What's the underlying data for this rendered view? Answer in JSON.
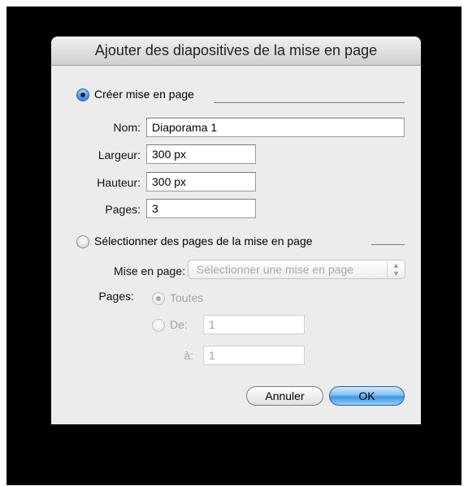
{
  "dialog": {
    "title": "Ajouter des diapositives de la mise en page",
    "create_option": {
      "label": "Créer mise en page",
      "selected": true,
      "fields": {
        "name_label": "Nom:",
        "name_value": "Diaporama 1",
        "width_label": "Largeur:",
        "width_value": "300 px",
        "height_label": "Hauteur:",
        "height_value": "300 px",
        "pages_label": "Pages:",
        "pages_value": "3"
      }
    },
    "select_option": {
      "label": "Sélectionner des pages de la mise en page",
      "selected": false,
      "layout_label": "Mise en page:",
      "layout_popup_value": "Sélectionner une mise en page",
      "pages_label": "Pages:",
      "all_label": "Toutes",
      "from_label": "De:",
      "from_value": "1",
      "to_label": "à:",
      "to_value": "1"
    },
    "buttons": {
      "cancel": "Annuler",
      "ok": "OK"
    }
  },
  "colors": {
    "backdrop": "#000000",
    "dialog_bg": "#ececec",
    "accent_blue": "#3a86de"
  },
  "icons": {
    "popup_arrows": "up-down-arrows-icon"
  }
}
